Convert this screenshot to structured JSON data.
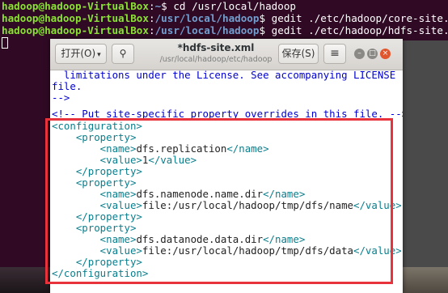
{
  "terminal": {
    "lines": [
      {
        "user": "hadoop@hadoop-VirtualBox",
        "sep": ":",
        "path": "~",
        "cmd": "$ cd /usr/local/hadoop"
      },
      {
        "user": "hadoop@hadoop-VirtualBox",
        "sep": ":",
        "path": "/usr/local/hadoop",
        "cmd": "$ gedit ./etc/hadoop/core-site.xml"
      },
      {
        "user": "hadoop@hadoop-VirtualBox",
        "sep": ":",
        "path": "/usr/local/hadoop",
        "cmd": "$ gedit ./etc/hadoop/hdfs-site.xml"
      }
    ]
  },
  "gedit": {
    "open_label": "打开(O)",
    "open_arrow": "▾",
    "pin_icon": "⚲",
    "title": "*hdfs-site.xml",
    "subtitle": "/usr/local/hadoop/etc/hadoop",
    "save_label": "保存(S)",
    "menu_icon": "≡",
    "min_icon": "–",
    "max_icon": "□",
    "close_icon": "×"
  },
  "editor": {
    "comment_lines": [
      "  limitations under the License. See accompanying LICENSE",
      "file.",
      "-->",
      "<!-- Put site-specific property overrides in this file. -->"
    ],
    "code_lines": [
      "<configuration>",
      "    <property>",
      "        <name>dfs.replication</name>",
      "        <value>1</value>",
      "    </property>",
      "    <property>",
      "        <name>dfs.namenode.name.dir</name>",
      "        <value>file:/usr/local/hadoop/tmp/dfs/name</value>",
      "    </property>",
      "    <property>",
      "        <name>dfs.datanode.data.dir</name>",
      "        <value>file:/usr/local/hadoop/tmp/dfs/data</value>",
      "    </property>",
      "</configuration>"
    ]
  },
  "colors": {
    "terminal_bg": "#300a24",
    "prompt_user": "#8ae234",
    "prompt_path": "#729fcf",
    "comment": "#0000d0",
    "tag": "#0a7e8c",
    "highlight_border": "#e8323c"
  }
}
